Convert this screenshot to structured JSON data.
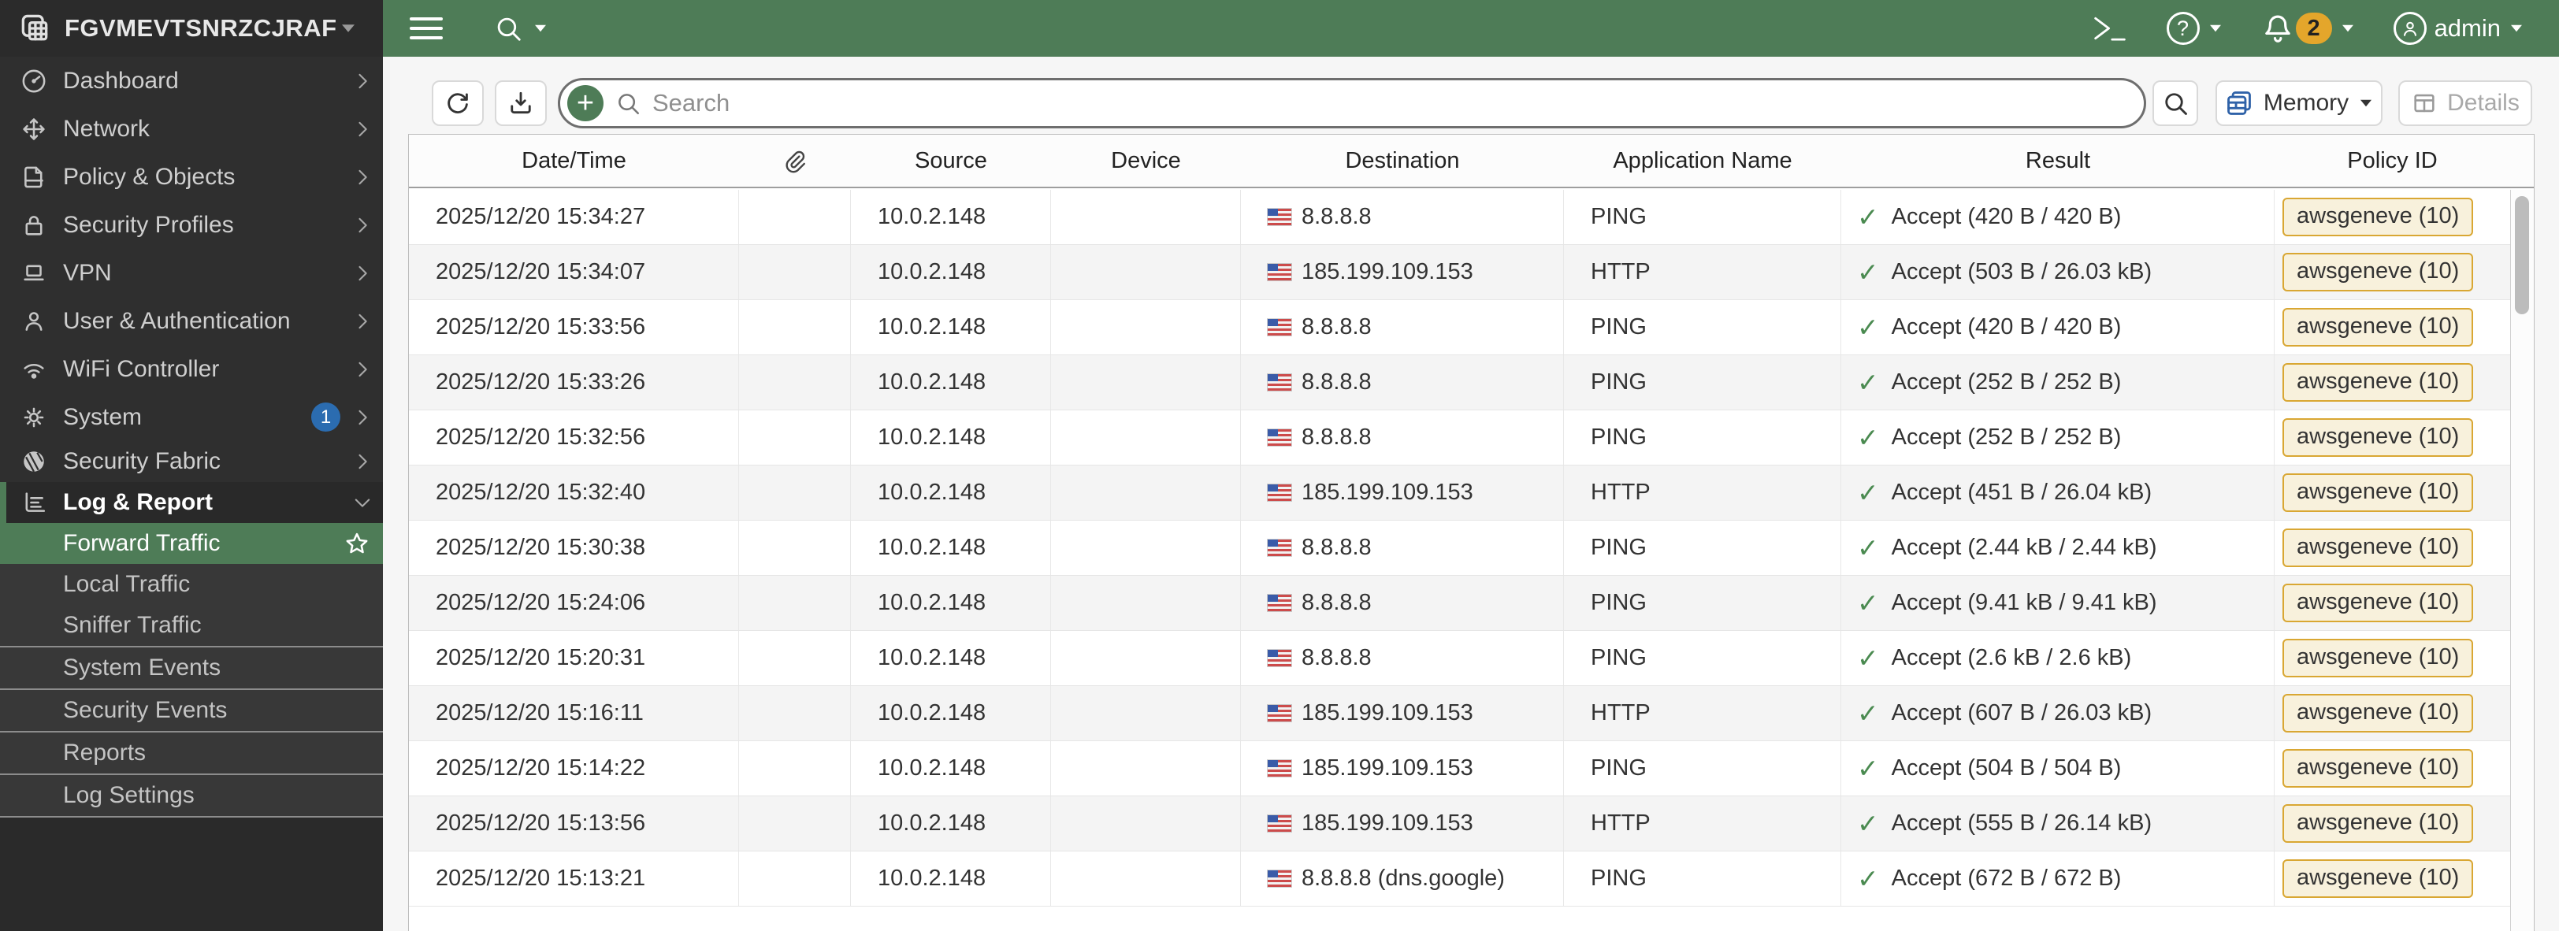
{
  "topbar": {
    "device_name": "FGVMEVTSNRZCJRAF",
    "notification_count": "2",
    "admin_label": "admin"
  },
  "sidebar": {
    "items": [
      {
        "label": "Dashboard"
      },
      {
        "label": "Network"
      },
      {
        "label": "Policy & Objects"
      },
      {
        "label": "Security Profiles"
      },
      {
        "label": "VPN"
      },
      {
        "label": "User & Authentication"
      },
      {
        "label": "WiFi Controller"
      },
      {
        "label": "System",
        "badge": "1"
      },
      {
        "label": "Security Fabric"
      },
      {
        "label": "Log & Report"
      }
    ],
    "log_report_items": [
      {
        "label": "Forward Traffic",
        "selected": true
      },
      {
        "label": "Local Traffic"
      },
      {
        "label": "Sniffer Traffic"
      },
      {
        "label": "System Events"
      },
      {
        "label": "Security Events"
      },
      {
        "label": "Reports"
      },
      {
        "label": "Log Settings"
      }
    ]
  },
  "toolbar": {
    "search_placeholder": "Search",
    "view_selector": "Memory",
    "details_label": "Details"
  },
  "table": {
    "columns": [
      "Date/Time",
      "",
      "Source",
      "Device",
      "Destination",
      "Application Name",
      "Result",
      "Policy ID"
    ],
    "rows": [
      {
        "datetime": "2025/12/20 15:34:27",
        "source": "10.0.2.148",
        "device": "",
        "destination": "8.8.8.8",
        "application": "PING",
        "result": "Accept (420 B / 420 B)",
        "policy": "awsgeneve (10)"
      },
      {
        "datetime": "2025/12/20 15:34:07",
        "source": "10.0.2.148",
        "device": "",
        "destination": "185.199.109.153",
        "application": "HTTP",
        "result": "Accept (503 B / 26.03 kB)",
        "policy": "awsgeneve (10)"
      },
      {
        "datetime": "2025/12/20 15:33:56",
        "source": "10.0.2.148",
        "device": "",
        "destination": "8.8.8.8",
        "application": "PING",
        "result": "Accept (420 B / 420 B)",
        "policy": "awsgeneve (10)"
      },
      {
        "datetime": "2025/12/20 15:33:26",
        "source": "10.0.2.148",
        "device": "",
        "destination": "8.8.8.8",
        "application": "PING",
        "result": "Accept (252 B / 252 B)",
        "policy": "awsgeneve (10)"
      },
      {
        "datetime": "2025/12/20 15:32:56",
        "source": "10.0.2.148",
        "device": "",
        "destination": "8.8.8.8",
        "application": "PING",
        "result": "Accept (252 B / 252 B)",
        "policy": "awsgeneve (10)"
      },
      {
        "datetime": "2025/12/20 15:32:40",
        "source": "10.0.2.148",
        "device": "",
        "destination": "185.199.109.153",
        "application": "HTTP",
        "result": "Accept (451 B / 26.04 kB)",
        "policy": "awsgeneve (10)"
      },
      {
        "datetime": "2025/12/20 15:30:38",
        "source": "10.0.2.148",
        "device": "",
        "destination": "8.8.8.8",
        "application": "PING",
        "result": "Accept (2.44 kB / 2.44 kB)",
        "policy": "awsgeneve (10)"
      },
      {
        "datetime": "2025/12/20 15:24:06",
        "source": "10.0.2.148",
        "device": "",
        "destination": "8.8.8.8",
        "application": "PING",
        "result": "Accept (9.41 kB / 9.41 kB)",
        "policy": "awsgeneve (10)"
      },
      {
        "datetime": "2025/12/20 15:20:31",
        "source": "10.0.2.148",
        "device": "",
        "destination": "8.8.8.8",
        "application": "PING",
        "result": "Accept (2.6 kB / 2.6 kB)",
        "policy": "awsgeneve (10)"
      },
      {
        "datetime": "2025/12/20 15:16:11",
        "source": "10.0.2.148",
        "device": "",
        "destination": "185.199.109.153",
        "application": "HTTP",
        "result": "Accept (607 B / 26.03 kB)",
        "policy": "awsgeneve (10)"
      },
      {
        "datetime": "2025/12/20 15:14:22",
        "source": "10.0.2.148",
        "device": "",
        "destination": "185.199.109.153",
        "application": "PING",
        "result": "Accept (504 B / 504 B)",
        "policy": "awsgeneve (10)"
      },
      {
        "datetime": "2025/12/20 15:13:56",
        "source": "10.0.2.148",
        "device": "",
        "destination": "185.199.109.153",
        "application": "HTTP",
        "result": "Accept (555 B / 26.14 kB)",
        "policy": "awsgeneve (10)"
      },
      {
        "datetime": "2025/12/20 15:13:21",
        "source": "10.0.2.148",
        "device": "",
        "destination": "8.8.8.8 (dns.google)",
        "application": "PING",
        "result": "Accept (672 B / 672 B)",
        "policy": "awsgeneve (10)"
      }
    ]
  },
  "colors": {
    "brand_green": "#4e7c57",
    "topbar_dark": "#2b2b2b",
    "sidebar_bg": "#2f2f2f",
    "accept_green": "#4a8a50",
    "policy_badge_bg": "#f8f1dc",
    "policy_badge_border": "#d9a733",
    "notification_yellow": "#e4a62b",
    "system_badge_blue": "#2b6cb0"
  }
}
